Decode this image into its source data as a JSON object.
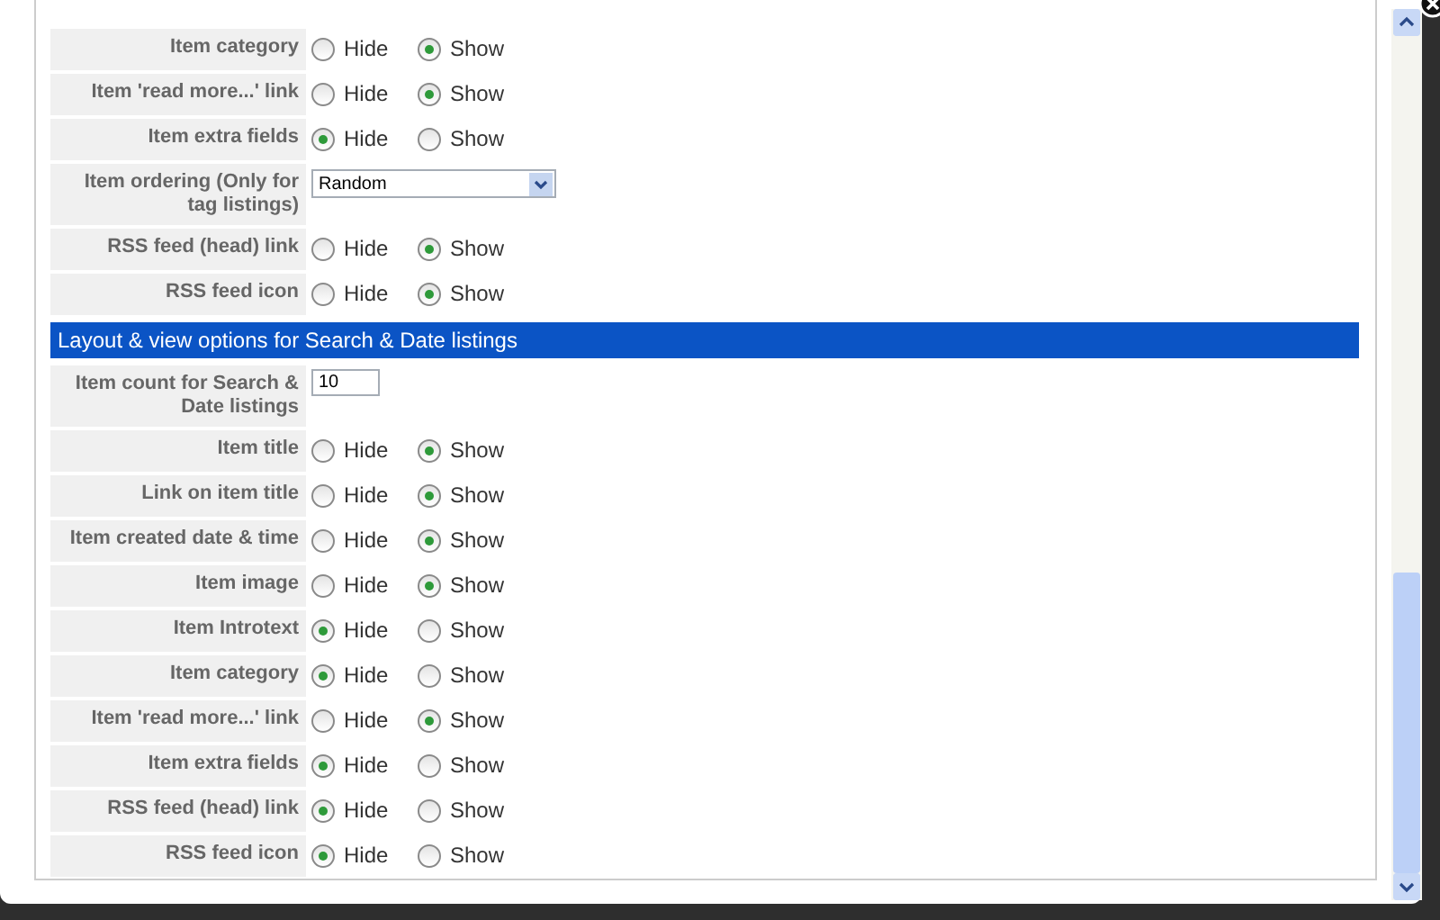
{
  "sections": [
    {
      "rows": [
        {
          "kind": "radio",
          "label": "Item category",
          "options": [
            {
              "label": "Hide",
              "selected": false
            },
            {
              "label": "Show",
              "selected": true
            }
          ]
        },
        {
          "kind": "radio",
          "label": "Item 'read more...' link",
          "options": [
            {
              "label": "Hide",
              "selected": false
            },
            {
              "label": "Show",
              "selected": true
            }
          ]
        },
        {
          "kind": "radio",
          "label": "Item extra fields",
          "options": [
            {
              "label": "Hide",
              "selected": true
            },
            {
              "label": "Show",
              "selected": false
            }
          ]
        },
        {
          "kind": "select",
          "label": "Item ordering (Only for tag listings)",
          "value": "Random"
        },
        {
          "kind": "radio",
          "label": "RSS feed (head) link",
          "options": [
            {
              "label": "Hide",
              "selected": false
            },
            {
              "label": "Show",
              "selected": true
            }
          ]
        },
        {
          "kind": "radio",
          "label": "RSS feed icon",
          "options": [
            {
              "label": "Hide",
              "selected": false
            },
            {
              "label": "Show",
              "selected": true
            }
          ]
        }
      ]
    },
    {
      "header": "Layout & view options for Search & Date listings",
      "rows": [
        {
          "kind": "text",
          "label": "Item count for Search & Date listings",
          "value": "10"
        },
        {
          "kind": "radio",
          "label": "Item title",
          "options": [
            {
              "label": "Hide",
              "selected": false
            },
            {
              "label": "Show",
              "selected": true
            }
          ]
        },
        {
          "kind": "radio",
          "label": "Link on item title",
          "options": [
            {
              "label": "Hide",
              "selected": false
            },
            {
              "label": "Show",
              "selected": true
            }
          ]
        },
        {
          "kind": "radio",
          "label": "Item created date & time",
          "options": [
            {
              "label": "Hide",
              "selected": false
            },
            {
              "label": "Show",
              "selected": true
            }
          ]
        },
        {
          "kind": "radio",
          "label": "Item image",
          "options": [
            {
              "label": "Hide",
              "selected": false
            },
            {
              "label": "Show",
              "selected": true
            }
          ]
        },
        {
          "kind": "radio",
          "label": "Item Introtext",
          "options": [
            {
              "label": "Hide",
              "selected": true
            },
            {
              "label": "Show",
              "selected": false
            }
          ]
        },
        {
          "kind": "radio",
          "label": "Item category",
          "options": [
            {
              "label": "Hide",
              "selected": true
            },
            {
              "label": "Show",
              "selected": false
            }
          ]
        },
        {
          "kind": "radio",
          "label": "Item 'read more...' link",
          "options": [
            {
              "label": "Hide",
              "selected": false
            },
            {
              "label": "Show",
              "selected": true
            }
          ]
        },
        {
          "kind": "radio",
          "label": "Item extra fields",
          "options": [
            {
              "label": "Hide",
              "selected": true
            },
            {
              "label": "Show",
              "selected": false
            }
          ]
        },
        {
          "kind": "radio",
          "label": "RSS feed (head) link",
          "options": [
            {
              "label": "Hide",
              "selected": true
            },
            {
              "label": "Show",
              "selected": false
            }
          ]
        },
        {
          "kind": "radio",
          "label": "RSS feed icon",
          "options": [
            {
              "label": "Hide",
              "selected": true
            },
            {
              "label": "Show",
              "selected": false
            }
          ]
        }
      ]
    }
  ]
}
